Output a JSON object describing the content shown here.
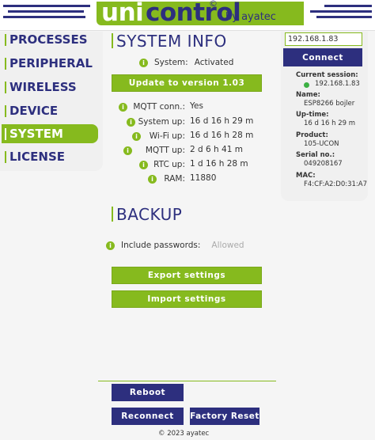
{
  "header": {
    "brand_uni": "uni",
    "brand_control": "control",
    "brand_reg": "©",
    "byline": "by ayatec"
  },
  "nav": {
    "items": [
      {
        "label": "PROCESSES"
      },
      {
        "label": "PERIPHERAL"
      },
      {
        "label": "WIRELESS"
      },
      {
        "label": "DEVICE"
      },
      {
        "label": "SYSTEM"
      },
      {
        "label": "LICENSE"
      }
    ],
    "active": "SYSTEM"
  },
  "system_info": {
    "title": "SYSTEM INFO",
    "status_label": "System:",
    "status_value": "Activated",
    "update_button": "Update to version 1.03",
    "rows": [
      {
        "label": "MQTT conn.:",
        "value": "Yes"
      },
      {
        "label": "System up:",
        "value": "16 d 16 h 29 m"
      },
      {
        "label": "Wi-Fi up:",
        "value": "16 d 16 h 28 m"
      },
      {
        "label": "MQTT up:",
        "value": "2 d 6 h 41 m"
      },
      {
        "label": "RTC up:",
        "value": "1 d 16 h 28 m"
      },
      {
        "label": "RAM:",
        "value": "11880"
      }
    ]
  },
  "backup": {
    "title": "BACKUP",
    "include_label": "Include passwords:",
    "include_value": "Allowed",
    "export_button": "Export settings",
    "import_button": "Import settings"
  },
  "actions": {
    "reboot": "Reboot",
    "reconnect": "Reconnect",
    "factory_reset": "Factory Reset"
  },
  "connection": {
    "ip_value": "192.168.1.83",
    "connect_button": "Connect",
    "current_session_label": "Current session:",
    "current_session_value": "192.168.1.83",
    "name_label": "Name:",
    "name_value": "ESP8266 bojler",
    "uptime_label": "Up-time:",
    "uptime_value": "16 d 16 h 29 m",
    "product_label": "Product:",
    "product_value": "105-UCON",
    "serial_label": "Serial no.:",
    "serial_value": "049208167",
    "mac_label": "MAC:",
    "mac_value": "F4:CF:A2:D0:31:A7"
  },
  "footer": {
    "copyright": "© 2023 ayatec"
  },
  "colors": {
    "navy": "#2d2f7e",
    "green": "#86ba1e",
    "session_dot": "#3cb043"
  },
  "icons": {
    "info": "info-icon",
    "session_status": "status-dot-icon"
  }
}
